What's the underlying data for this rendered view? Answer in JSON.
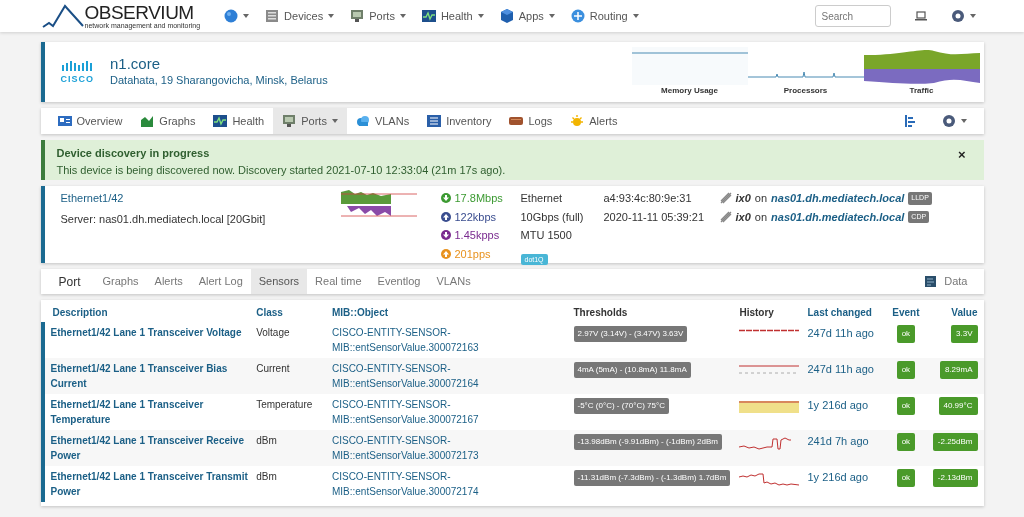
{
  "navbar": {
    "logo": "OBSERVIUM",
    "tagline": "network management and monitoring",
    "menu": [
      {
        "kind": "globe"
      },
      {
        "kind": "server",
        "label": "Devices"
      },
      {
        "kind": "port",
        "label": "Ports"
      },
      {
        "kind": "health",
        "label": "Health"
      },
      {
        "kind": "apps",
        "label": "Apps"
      },
      {
        "kind": "routing",
        "label": "Routing"
      }
    ],
    "search": {
      "placeholder": "Search"
    }
  },
  "device": {
    "vendor": "CISCO",
    "name": "n1.core",
    "location": "Datahata, 19 Sharangovicha, Minsk, Belarus",
    "graphs": [
      {
        "kind": "memory",
        "label": "Memory Usage"
      },
      {
        "kind": "processors",
        "label": "Processors"
      },
      {
        "kind": "traffic",
        "label": "Traffic"
      }
    ]
  },
  "device_tabs": [
    {
      "kind": "overview",
      "label": "Overview",
      "selected": false,
      "dropdown": false
    },
    {
      "kind": "graphs",
      "label": "Graphs",
      "selected": false,
      "dropdown": false
    },
    {
      "kind": "health",
      "label": "Health",
      "selected": false,
      "dropdown": false
    },
    {
      "kind": "port",
      "label": "Ports",
      "selected": true,
      "dropdown": true
    },
    {
      "kind": "vlans",
      "label": "VLANs",
      "selected": false,
      "dropdown": false
    },
    {
      "kind": "inventory",
      "label": "Inventory",
      "selected": false,
      "dropdown": false
    },
    {
      "kind": "logs",
      "label": "Logs",
      "selected": false,
      "dropdown": false
    },
    {
      "kind": "alerts",
      "label": "Alerts",
      "selected": false,
      "dropdown": false
    }
  ],
  "alert": {
    "title": "Device discovery in progress",
    "message": "This device is being discovered now. Discovery started 2021-07-10 12:33:04 (21m 17s ago).",
    "close": "×"
  },
  "port": {
    "name": "Ethernet1/42",
    "description": "Server: nas01.dh.mediatech.local [20Gbit]",
    "rates": [
      {
        "kind": "down",
        "text": "17.8Mbps",
        "color": "#3c9a32"
      },
      {
        "kind": "up",
        "text": "122kbps",
        "color": "#3a4d8f"
      },
      {
        "kind": "down",
        "text": "1.45kpps",
        "color": "#7a2b8f"
      },
      {
        "kind": "up",
        "text": "201pps",
        "color": "#e8921e"
      }
    ],
    "details": [
      "Ethernet",
      "10Gbps (full)",
      "MTU 1500"
    ],
    "tag": "dot1Q",
    "addresses": [
      "a4:93:4c:80:9e:31",
      "2020-11-11 05:39:21"
    ],
    "neighbours": [
      {
        "interface": "ix0",
        "joiner": "on",
        "host": "nas01.dh.mediatech.local",
        "protocol": "LLDP"
      },
      {
        "interface": "ix0",
        "joiner": "on",
        "host": "nas01.dh.mediatech.local",
        "protocol": "CDP"
      }
    ]
  },
  "port_tabs": [
    {
      "label": "Port",
      "selected": false,
      "kind": "title"
    },
    {
      "label": "Graphs",
      "selected": false,
      "kind": "tab"
    },
    {
      "label": "Alerts",
      "selected": false,
      "kind": "tab"
    },
    {
      "label": "Alert Log",
      "selected": false,
      "kind": "tab"
    },
    {
      "label": "Sensors",
      "selected": true,
      "kind": "tab"
    },
    {
      "label": "Real time",
      "selected": false,
      "kind": "tab"
    },
    {
      "label": "Eventlog",
      "selected": false,
      "kind": "tab"
    },
    {
      "label": "VLANs",
      "selected": false,
      "kind": "tab"
    }
  ],
  "data_button": "Data",
  "table": {
    "columns": [
      {
        "label": "Description",
        "sortable": true
      },
      {
        "label": "Class",
        "sortable": true
      },
      {
        "label": "MIB::Object",
        "sortable": true
      },
      {
        "label": "Thresholds",
        "sortable": false
      },
      {
        "label": "History",
        "sortable": false
      },
      {
        "label": "Last changed",
        "sortable": true
      },
      {
        "label": "Event",
        "sortable": true
      },
      {
        "label": "Value",
        "sortable": true
      }
    ],
    "rows": [
      {
        "description": "Ethernet1/42 Lane 1 Transceiver Voltage",
        "class": "Voltage",
        "mib_prefix": "CISCO-ENTITY-SENSOR-",
        "mib_object": "MIB::entSensorValue.300072163",
        "thresholds": "2.97V (3.14V) - (3.47V) 3.63V",
        "kind": "flat",
        "last_changed": "247d 11h ago",
        "event": "ok",
        "value": "3.3V"
      },
      {
        "description": "Ethernet1/42 Lane 1 Transceiver Bias Current",
        "class": "Current",
        "mib_prefix": "CISCO-ENTITY-SENSOR-",
        "mib_object": "MIB::entSensorValue.300072164",
        "thresholds": "4mA (5mA) - (10.8mA) 11.8mA",
        "kind": "line",
        "last_changed": "247d 11h ago",
        "event": "ok",
        "value": "8.29mA"
      },
      {
        "description": "Ethernet1/42 Lane 1 Transceiver Temperature",
        "class": "Temperature",
        "mib_prefix": "CISCO-ENTITY-SENSOR-",
        "mib_object": "MIB::entSensorValue.300072167",
        "thresholds": "-5°C (0°C) - (70°C) 75°C",
        "kind": "filled",
        "last_changed": "1y 216d ago",
        "event": "ok",
        "value": "40.99°C"
      },
      {
        "description": "Ethernet1/42 Lane 1 Transceiver Receive Power",
        "class": "dBm",
        "mib_prefix": "CISCO-ENTITY-SENSOR-",
        "mib_object": "MIB::entSensorValue.300072173",
        "thresholds": "-13.98dBm (-9.91dBm) - (-1dBm) 2dBm",
        "kind": "steps",
        "last_changed": "241d 7h ago",
        "event": "ok",
        "value": "-2.25dBm"
      },
      {
        "description": "Ethernet1/42 Lane 1 Transceiver Transmit Power",
        "class": "dBm",
        "mib_prefix": "CISCO-ENTITY-SENSOR-",
        "mib_object": "MIB::entSensorValue.300072174",
        "thresholds": "-11.31dBm (-7.3dBm) - (-1.3dBm) 1.7dBm",
        "kind": "drop",
        "last_changed": "1y 216d ago",
        "event": "ok",
        "value": "-2.13dBm"
      }
    ]
  }
}
